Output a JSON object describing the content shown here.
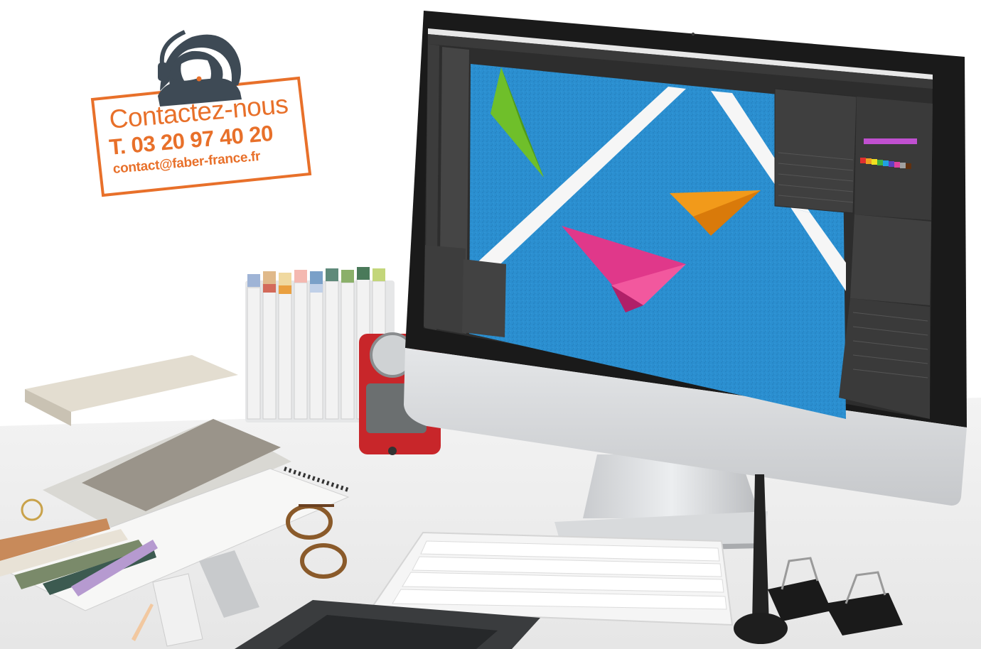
{
  "contact_badge": {
    "title": "Contactez-nous",
    "phone": "T. 03 20 97 40 20",
    "email": "contact@faber-france.fr",
    "accent_color": "#e8702a",
    "icon": "headset-agent-icon"
  },
  "monitor": {
    "app_theme": "dark",
    "canvas_color": "#2b8fd0",
    "paper_planes": [
      "green",
      "orange",
      "pink"
    ]
  },
  "desk_objects": [
    "keyboard",
    "stylus-pen",
    "binder-clips",
    "marker-set",
    "pencil-sharpener",
    "glasses",
    "notebooks",
    "color-swatches",
    "ruler",
    "graphics-tablet"
  ]
}
